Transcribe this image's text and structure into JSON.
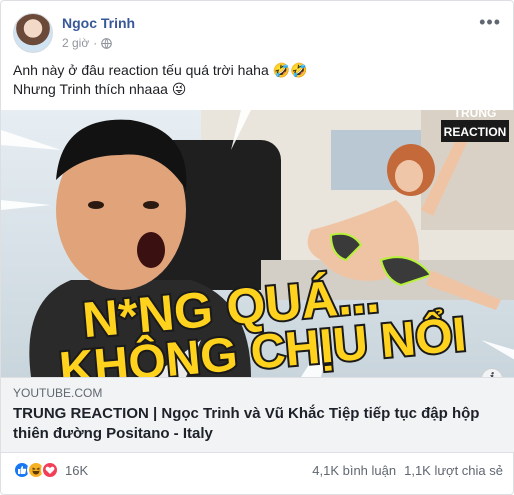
{
  "post": {
    "author": "Ngoc Trinh",
    "time": "2 giờ",
    "time_separator": "·",
    "more_icon": "more-horizontal-icon",
    "privacy_icon": "globe-icon",
    "text_lines": [
      "Anh này ở đâu reaction tếu quá trời haha 🤣🤣",
      "Nhưng Trinh thích nhaaa 😜"
    ]
  },
  "media": {
    "overlay_line1": "N*NG QUÁ...",
    "overlay_line2": "KHÔNG CHỊU NỔI",
    "badge_top": "TRUNG",
    "badge_bottom": "REACTION",
    "info_label": "i"
  },
  "link": {
    "domain": "YOUTUBE.COM",
    "title": "TRUNG REACTION | Ngọc Trinh và Vũ Khắc Tiệp tiếp tục đập hộp thiên đường Positano - Italy"
  },
  "footer": {
    "reaction_icons": [
      "like-icon",
      "haha-icon",
      "love-icon"
    ],
    "reaction_count": "16K",
    "comments": "4,1K bình luận",
    "shares": "1,1K lượt chia sẻ"
  },
  "colors": {
    "link_blue": "#385898",
    "secondary_text": "#90949c",
    "like_blue": "#1877f2",
    "haha_yellow": "#f7b125",
    "love_red": "#f33e58",
    "overlay_yellow": "#ffd21e",
    "overlay_outline": "#1a1a1a"
  }
}
